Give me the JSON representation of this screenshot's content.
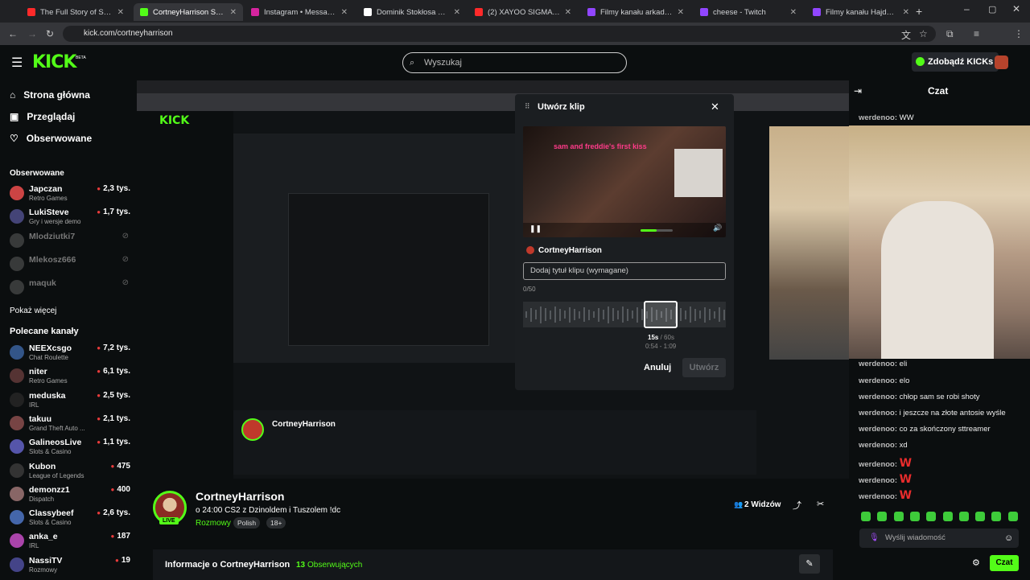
{
  "browser": {
    "tabs": [
      {
        "title": "The Full Story of Seddie",
        "fav": "#ff2a2a"
      },
      {
        "title": "CortneyHarrison Stre...",
        "fav": "#53fc18"
      },
      {
        "title": "Instagram • Messages",
        "fav": "#d6249f"
      },
      {
        "title": "Dominik Stokłosa w serwi...",
        "fav": "#ffffff"
      },
      {
        "title": "(2) XAYOO SIGMA NA ZL...",
        "fav": "#ff2a2a"
      },
      {
        "title": "Filmy kanału arkadiojose...",
        "fav": "#9146ff"
      },
      {
        "title": "cheese - Twitch",
        "fav": "#9146ff"
      },
      {
        "title": "Filmy kanału Hajdook - T...",
        "fav": "#9146ff"
      }
    ],
    "url": "kick.com/cortneyharrison"
  },
  "header": {
    "logo": "KICK",
    "logo_badge": "BETA",
    "search_placeholder": "Wyszukaj",
    "kicks_button": "Zdobądź KICKs"
  },
  "sidebar": {
    "nav": [
      {
        "label": "Strona główna",
        "icon": "home-icon"
      },
      {
        "label": "Przeglądaj",
        "icon": "browse-icon"
      },
      {
        "label": "Obserwowane",
        "icon": "heart-icon"
      }
    ],
    "followed_header": "Obserwowane",
    "followed": [
      {
        "name": "Japczan",
        "category": "Retro Games",
        "viewers": "2,3 tys.",
        "live": true,
        "color": "#c44"
      },
      {
        "name": "LukiSteve",
        "category": "Gry i wersje demo",
        "viewers": "1,7 tys.",
        "live": true,
        "color": "#447"
      },
      {
        "name": "Mlodziutki7",
        "category": "",
        "viewers": "",
        "live": false,
        "color": "#666"
      },
      {
        "name": "Mlekosz666",
        "category": "",
        "viewers": "",
        "live": false,
        "color": "#666"
      },
      {
        "name": "maquk",
        "category": "",
        "viewers": "",
        "live": false,
        "color": "#666"
      }
    ],
    "show_more": "Pokaż więcej",
    "recommended_header": "Polecane kanały",
    "recommended": [
      {
        "name": "NEEXcsgo",
        "category": "Chat Roulette",
        "viewers": "7,2 tys.",
        "color": "#358"
      },
      {
        "name": "niter",
        "category": "Retro Games",
        "viewers": "6,1 tys.",
        "color": "#533"
      },
      {
        "name": "meduska",
        "category": "IRL",
        "viewers": "2,5 tys.",
        "color": "#222"
      },
      {
        "name": "takuu",
        "category": "Grand Theft Auto ...",
        "viewers": "2,1 tys.",
        "color": "#744"
      },
      {
        "name": "GalineosLive",
        "category": "Slots & Casino",
        "viewers": "1,1 tys.",
        "color": "#55a"
      },
      {
        "name": "Kubon",
        "category": "League of Legends",
        "viewers": "475",
        "color": "#333"
      },
      {
        "name": "demonzz1",
        "category": "Dispatch",
        "viewers": "400",
        "color": "#866"
      },
      {
        "name": "Classybeef",
        "category": "Slots & Casino",
        "viewers": "2,6 tys.",
        "color": "#46a"
      },
      {
        "name": "anka_e",
        "category": "IRL",
        "viewers": "187",
        "color": "#a4a"
      },
      {
        "name": "NassiTV",
        "category": "Rozmowy",
        "viewers": "19",
        "color": "#448"
      }
    ]
  },
  "modal": {
    "title": "Utwórz klip",
    "video_caption": "sam and freddie's first kiss",
    "streamer": "CortneyHarrison",
    "title_placeholder": "Dodaj tytuł klipu (wymagane)",
    "char_count": "0/50",
    "duration_selected": "15s",
    "duration_max": "/ 60s",
    "range": "0:54 - 1:09",
    "cancel": "Anuluj",
    "create": "Utwórz",
    "volume_level": 0.5
  },
  "stream": {
    "name": "CortneyHarrison",
    "title": "o 24:00 CS2 z Dzinoldem i Tuszolem !dc",
    "category": "Rozmowy",
    "tags": [
      "Polish",
      "18+"
    ],
    "live_badge": "LIVE",
    "viewers": "2 Widzów",
    "about": "Informacje o CortneyHarrison",
    "followers_count": "13",
    "followers_label": "Obserwujących"
  },
  "chat": {
    "title": "Czat",
    "messages": [
      {
        "user": "werdenoo:",
        "text": "WW"
      },
      {
        "user": "werdenoo:",
        "text": "eli"
      },
      {
        "user": "werdenoo:",
        "text": "elo"
      },
      {
        "user": "werdenoo:",
        "text": "chłop sam se robi shoty"
      },
      {
        "user": "werdenoo:",
        "text": "i jeszcze na złote antosie wyśle"
      },
      {
        "user": "werdenoo:",
        "text": "co za skończony sttreamer"
      },
      {
        "user": "werdenoo:",
        "text": "xd"
      },
      {
        "user": "werdenoo:",
        "text": "W"
      },
      {
        "user": "werdenoo:",
        "text": "W"
      },
      {
        "user": "werdenoo:",
        "text": "W"
      }
    ],
    "input_placeholder": "Wyślij wiadomość",
    "send": "Czat"
  }
}
